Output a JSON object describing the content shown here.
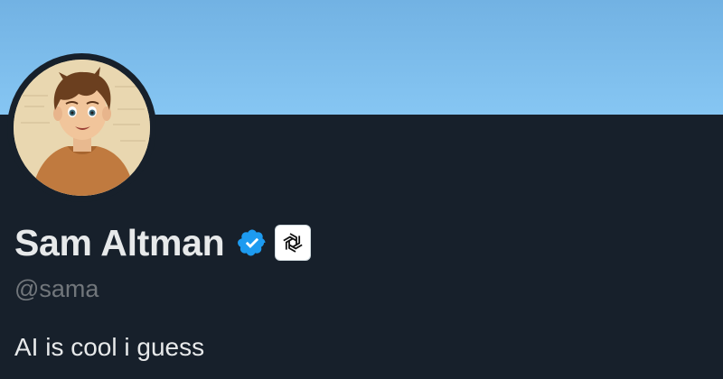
{
  "profile": {
    "display_name": "Sam Altman",
    "handle": "@sama",
    "bio": "AI is cool i guess",
    "verified": true,
    "verified_icon": "verified-badge-icon",
    "affiliate_icon": "openai-logo-icon",
    "avatar": "avatar-illustration"
  },
  "colors": {
    "banner": "#7ab9ea",
    "background": "#17202b",
    "name": "#e7e9ea",
    "handle": "#71767b",
    "verified": "#1d9bf0"
  }
}
